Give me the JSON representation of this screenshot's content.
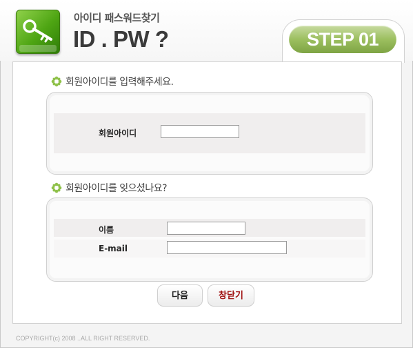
{
  "header": {
    "subtitle": "아이디 패스워드찾기",
    "title": "ID . PW ?",
    "step": "STEP 01"
  },
  "section1": {
    "title": "회원아이디를 입력해주세요.",
    "id_label": "회원아이디",
    "id_value": ""
  },
  "section2": {
    "title": "회원아이디를 잊으셨나요?",
    "name_label": "이름",
    "name_value": "",
    "email_label": "E-mail",
    "email_value": ""
  },
  "buttons": {
    "next": "다음",
    "close": "창닫기"
  },
  "footer": {
    "copyright": "COPYRIGHT(c) 2008 ..ALL RIGHT RESERVED."
  },
  "colors": {
    "accent_green": "#9cbf5f",
    "close_text": "#a01010"
  },
  "icons": {
    "logo": "key-icon",
    "bullet": "flower-bullet-icon"
  }
}
